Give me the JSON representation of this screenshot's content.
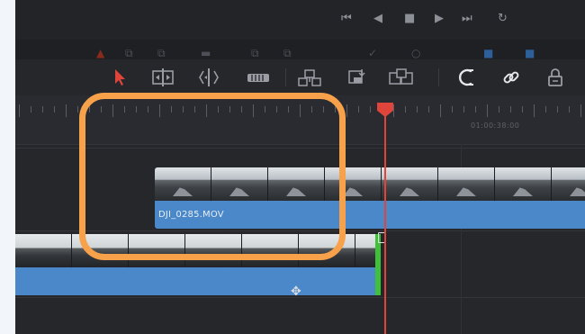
{
  "transport": {
    "buttons": [
      {
        "name": "skip-to-start-icon",
        "glyph": "⏮"
      },
      {
        "name": "step-back-icon",
        "glyph": "◀"
      },
      {
        "name": "stop-icon",
        "glyph": "■"
      },
      {
        "name": "play-icon",
        "glyph": "▶"
      },
      {
        "name": "skip-to-end-icon",
        "glyph": "⏭"
      },
      {
        "name": "loop-icon",
        "glyph": "↻"
      }
    ]
  },
  "toolbar": {
    "tools": [
      {
        "name": "selection-arrow-icon",
        "color": "#e0453c"
      },
      {
        "name": "trim-edit-icon"
      },
      {
        "name": "dynamic-trim-icon"
      },
      {
        "name": "blade-icon"
      },
      {
        "name": "insert-clip-icon"
      },
      {
        "name": "overwrite-clip-icon"
      },
      {
        "name": "replace-clip-icon"
      },
      {
        "name": "snapping-icon"
      },
      {
        "name": "linked-selection-icon"
      },
      {
        "name": "position-lock-icon"
      }
    ]
  },
  "ruler": {
    "timecode": "01:00:38:00"
  },
  "clips": {
    "upper": {
      "label": "DJI_0285.MOV"
    }
  },
  "colors": {
    "clip_blue": "#4a88c9",
    "playhead": "#e0453c",
    "highlight": "#f7a14a",
    "trim_green": "#3fbf3a"
  }
}
